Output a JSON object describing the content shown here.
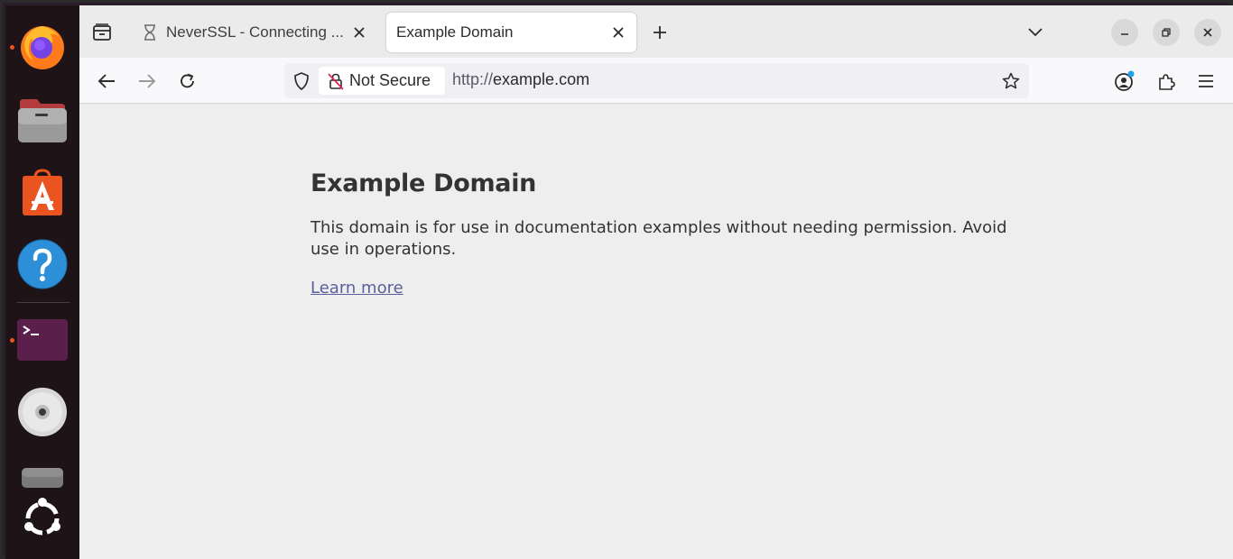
{
  "browser": {
    "tabs": [
      {
        "title": "NeverSSL - Connecting ...",
        "state": "loading"
      },
      {
        "title": "Example Domain",
        "state": "active"
      }
    ]
  },
  "toolbar": {
    "security_label": "Not Secure",
    "url_scheme": "http://",
    "url_host": "example.com"
  },
  "page": {
    "heading": "Example Domain",
    "paragraph": "This domain is for use in documentation examples without needing permission. Avoid use in operations.",
    "link": "Learn more"
  },
  "dock": {
    "items": [
      "firefox-icon",
      "files-icon",
      "app-center-icon",
      "help-icon",
      "terminal-icon",
      "optical-disc-icon",
      "drive-icon",
      "ubuntu-logo-icon"
    ],
    "accent": "#e95420"
  },
  "colors": {
    "link": "#5c5f9e",
    "page_background": "#eeeeee"
  }
}
